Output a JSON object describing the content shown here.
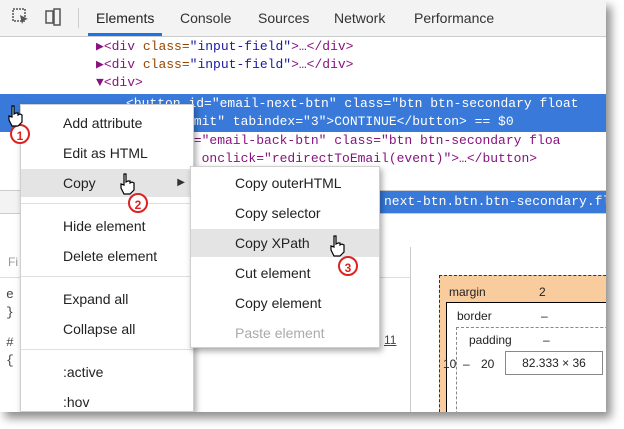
{
  "tabs": {
    "elements": "Elements",
    "console": "Console",
    "sources": "Sources",
    "network": "Network",
    "performance": "Performance"
  },
  "dom": {
    "line1": {
      "tag_open": "<div ",
      "attr": "class=",
      "val": "\"input-field\"",
      "rest": ">…</div>"
    },
    "line2": {
      "tag_open": "<div ",
      "attr": "class=",
      "val": "\"input-field\"",
      "rest": ">…</div>"
    },
    "line3": {
      "text": "<div>"
    },
    "sel_line1": "<button id=\"email-next-btn\" class=\"btn btn-secondary float",
    "sel_line2": "omit\" tabindex=\"3\">CONTINUE</button> == $0",
    "line6": "d=\"email-back-btn\" class=\"btn btn-secondary floa",
    "line7": "\" onclick=\"redirectToEmail(event)\">…</button>"
  },
  "breadcrumb": {
    "selected": "next-btn.btn.btn-secondary.float"
  },
  "context_menu": {
    "items": [
      "Add attribute",
      "Edit as HTML",
      "Copy",
      "Hide element",
      "Delete element",
      "Expand all",
      "Collapse all",
      ":active",
      ":hov"
    ]
  },
  "copy_submenu": {
    "items": [
      "Copy outerHTML",
      "Copy selector",
      "Copy XPath",
      "Cut element",
      "Copy element",
      "Paste element"
    ]
  },
  "box_model": {
    "margin_label": "margin",
    "margin_value": "2",
    "border_label": "border",
    "border_value": "–",
    "padding_label": "padding",
    "padding_value": "–",
    "left_margin": "10",
    "left_border": "–",
    "left_padding": "20",
    "content": "82.333 × 36"
  },
  "styles_fragments": {
    "filter": "Fi",
    "e": "e",
    "brace": "}",
    "hash": "#",
    "brace2": "{",
    "hov": "hov",
    "line_no": "11"
  },
  "callouts": [
    "1",
    "2",
    "3"
  ],
  "colors": {
    "selection": "#3879d9",
    "tab_accent": "#1a73e8",
    "badge": "#dd2222",
    "margin_fill": "#f9cc9d"
  }
}
